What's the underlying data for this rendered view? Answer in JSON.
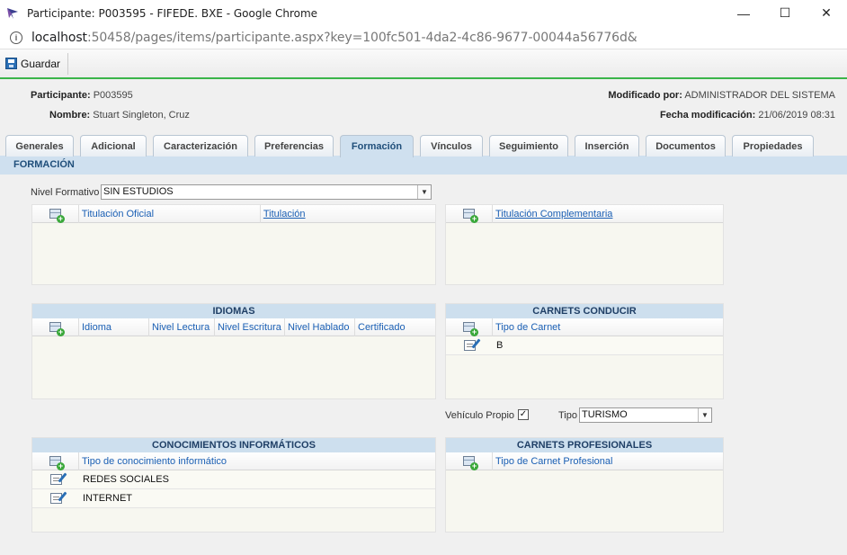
{
  "window": {
    "title": "Participante: P003595 - FIFEDE. BXE - Google Chrome",
    "url_host": "localhost",
    "url_rest": ":50458/pages/items/participante.aspx?key=100fc501-4da2-4c86-9677-00044a56776d&",
    "minimize": "—",
    "maximize": "☐",
    "close": "✕"
  },
  "toolbar": {
    "save_label": "Guardar"
  },
  "header": {
    "participante_label": "Participante:",
    "participante_value": "P003595",
    "nombre_label": "Nombre:",
    "nombre_value": "Stuart Singleton, Cruz",
    "modificado_label": "Modificado por:",
    "modificado_value": "ADMINISTRADOR DEL SISTEMA",
    "fecha_label": "Fecha modificación:",
    "fecha_value": "21/06/2019 08:31"
  },
  "tabs": [
    {
      "label": "Generales"
    },
    {
      "label": "Adicional"
    },
    {
      "label": "Caracterización"
    },
    {
      "label": "Preferencias"
    },
    {
      "label": "Formación"
    },
    {
      "label": "Vínculos"
    },
    {
      "label": "Seguimiento"
    },
    {
      "label": "Inserción"
    },
    {
      "label": "Documentos"
    },
    {
      "label": "Propiedades"
    }
  ],
  "section_title": "FORMACIÓN",
  "nivel": {
    "label": "Nivel Formativo",
    "value": "SIN ESTUDIOS"
  },
  "titulaciones": {
    "col1": "Titulación Oficial",
    "col2": "Titulación"
  },
  "complementaria": {
    "col1": "Titulación Complementaria"
  },
  "idiomas": {
    "title": "IDIOMAS",
    "cols": [
      "Idioma",
      "Nivel Lectura",
      "Nivel Escritura",
      "Nivel Hablado",
      "Certificado"
    ]
  },
  "carnets_conducir": {
    "title": "CARNETS CONDUCIR",
    "col1": "Tipo de Carnet",
    "rows": [
      "B"
    ]
  },
  "vehiculo": {
    "label": "Vehículo Propio",
    "check": "✓",
    "tipo_label": "Tipo",
    "tipo_value": "TURISMO"
  },
  "informaticos": {
    "title": "CONOCIMIENTOS INFORMÁTICOS",
    "col1": "Tipo de conocimiento informático",
    "rows": [
      "REDES SOCIALES",
      "INTERNET"
    ]
  },
  "profesionales": {
    "title": "CARNETS PROFESIONALES",
    "col1": "Tipo de Carnet Profesional"
  }
}
